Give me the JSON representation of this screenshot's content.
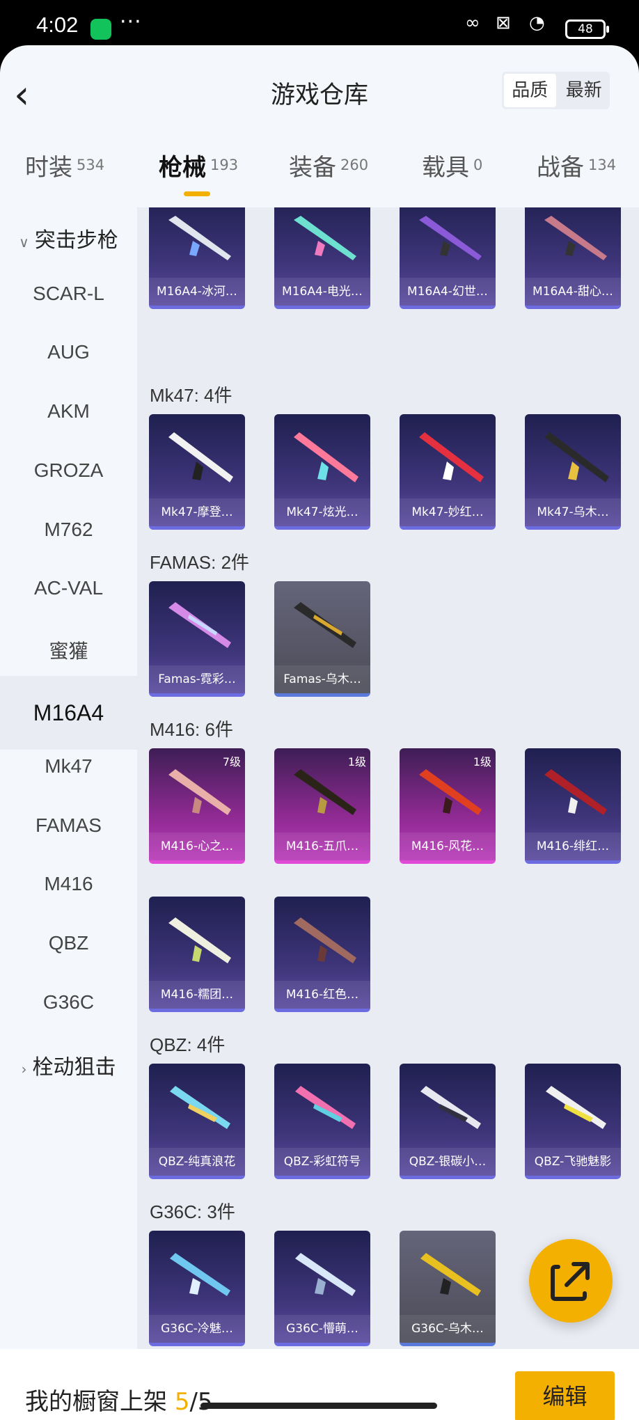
{
  "status": {
    "time": "4:02",
    "dots": "···",
    "battery": "48"
  },
  "header": {
    "title": "游戏仓库",
    "sort_options": [
      "品质",
      "最新"
    ]
  },
  "tabs": [
    {
      "label": "时装",
      "count": "534"
    },
    {
      "label": "枪械",
      "count": "193"
    },
    {
      "label": "装备",
      "count": "260"
    },
    {
      "label": "载具",
      "count": "0"
    },
    {
      "label": "战备",
      "count": "134"
    }
  ],
  "sidebar": {
    "group_top": "突击步枪",
    "items": [
      "SCAR-L",
      "AUG",
      "AKM",
      "GROZA",
      "M762",
      "AC-VAL",
      "蜜獾",
      "M16A4",
      "Mk47",
      "FAMAS",
      "M416",
      "QBZ",
      "G36C"
    ],
    "active": "M16A4",
    "group_bottom": "栓动狙击"
  },
  "sections": [
    {
      "title": "",
      "items": [
        {
          "name": "M16A4-冰河…"
        },
        {
          "name": "M16A4-电光…"
        },
        {
          "name": "M16A4-幻世…"
        },
        {
          "name": "M16A4-甜心…"
        }
      ]
    },
    {
      "title": "Mk47: 4件",
      "items": [
        {
          "name": "Mk47-摩登…"
        },
        {
          "name": "Mk47-炫光…"
        },
        {
          "name": "Mk47-妙红…"
        },
        {
          "name": "Mk47-乌木…"
        }
      ]
    },
    {
      "title": "FAMAS: 2件",
      "items": [
        {
          "name": "Famas-霓彩…"
        },
        {
          "name": "Famas-乌木…"
        }
      ]
    },
    {
      "title": "M416: 6件",
      "items": [
        {
          "name": "M416-心之…",
          "level": "7级"
        },
        {
          "name": "M416-五爪…",
          "level": "1级"
        },
        {
          "name": "M416-风花…",
          "level": "1级"
        },
        {
          "name": "M416-绯红…"
        },
        {
          "name": "M416-糯团…"
        },
        {
          "name": "M416-红色…"
        }
      ]
    },
    {
      "title": "QBZ: 4件",
      "items": [
        {
          "name": "QBZ-纯真浪花"
        },
        {
          "name": "QBZ-彩虹符号"
        },
        {
          "name": "QBZ-银碳小…"
        },
        {
          "name": "QBZ-飞驰魅影"
        }
      ]
    },
    {
      "title": "G36C: 3件",
      "items": [
        {
          "name": "G36C-冷魅…"
        },
        {
          "name": "G36C-懵萌…"
        },
        {
          "name": "G36C-乌木…"
        }
      ]
    }
  ],
  "footer": {
    "shelf_label": "我的橱窗上架 ",
    "shelf_used": "5",
    "shelf_total": "/5",
    "edit_label": "编辑"
  },
  "colors": {
    "accent": "#f4b000"
  }
}
